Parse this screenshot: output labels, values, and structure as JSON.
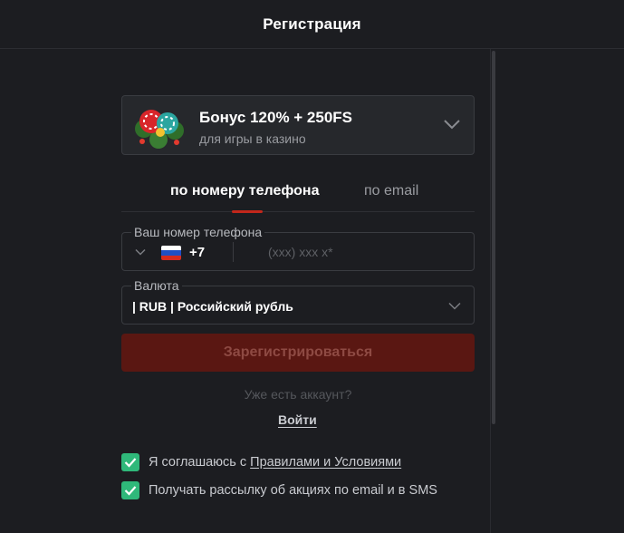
{
  "header": {
    "title": "Регистрация"
  },
  "bonus": {
    "title": "Бонус 120% + 250FS",
    "subtitle": "для игры в казино",
    "art_icon": "casino-chips-wreath-icon",
    "expand_icon": "chevron-down-icon"
  },
  "tabs": [
    {
      "label": "по номеру телефона",
      "active": true
    },
    {
      "label": "по email",
      "active": false
    }
  ],
  "phone": {
    "label": "Ваш номер телефона",
    "country_flag": "russia-flag-icon",
    "code": "+7",
    "placeholder": "(xxx) xxx x*",
    "value": ""
  },
  "currency": {
    "label": "Валюта",
    "value": "| RUB | Российский рубль"
  },
  "register_button": {
    "label": "Зарегистрироваться"
  },
  "have_account": {
    "text": "Уже есть аккаунт?",
    "login_label": "Войти"
  },
  "agreements": {
    "terms_prefix": "Я соглашаюсь с ",
    "terms_link": "Правилами и Условиями",
    "terms_checked": true,
    "newsletter": "Получать рассылку об акциях по email и в SMS",
    "newsletter_checked": true
  },
  "colors": {
    "background": "#1c1d21",
    "accent_red": "#c2271b",
    "button_disabled": "#5a1712",
    "checkbox_green": "#2fb87a"
  }
}
